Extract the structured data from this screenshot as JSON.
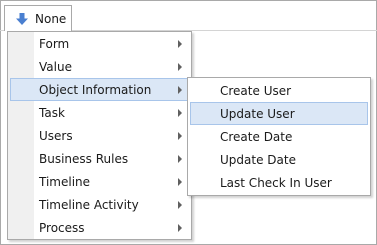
{
  "filter_button": {
    "label": "None",
    "icon": "arrow-down-icon"
  },
  "main_menu": {
    "items": [
      {
        "label": "Form"
      },
      {
        "label": "Value"
      },
      {
        "label": "Object Information"
      },
      {
        "label": "Task"
      },
      {
        "label": "Users"
      },
      {
        "label": "Business Rules"
      },
      {
        "label": "Timeline"
      },
      {
        "label": "Timeline Activity"
      },
      {
        "label": "Process"
      }
    ],
    "active_item": "Object Information"
  },
  "submenu": {
    "items": [
      {
        "label": "Create User"
      },
      {
        "label": "Update User"
      },
      {
        "label": "Create Date"
      },
      {
        "label": "Update Date"
      },
      {
        "label": "Last Check In User"
      }
    ],
    "hovered_item": "Update User"
  },
  "colors": {
    "highlight": "#dbe7f6",
    "highlight_border": "#a8c5ea",
    "icon_blue": "#4a7fd0"
  }
}
